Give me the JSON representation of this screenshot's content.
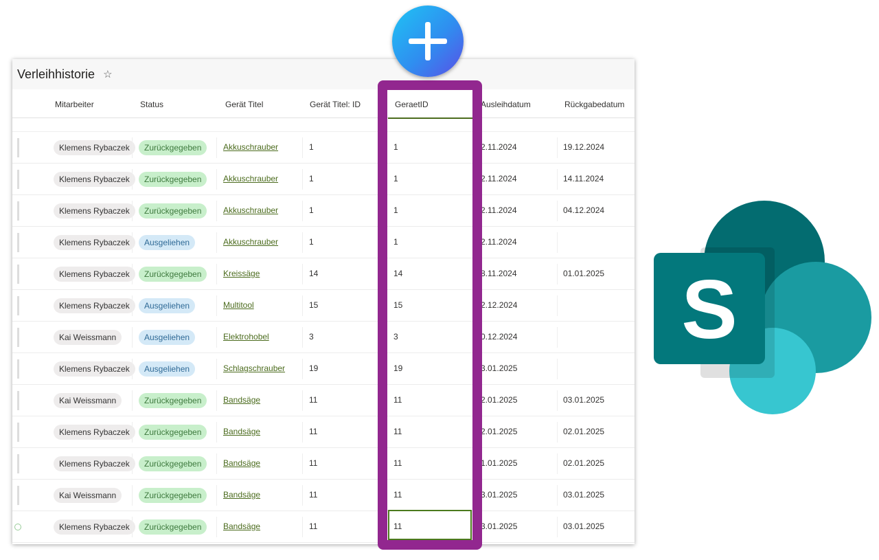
{
  "title": "Verleihhistorie",
  "columns": [
    "Mitarbeiter",
    "Status",
    "Gerät Titel",
    "Gerät Titel: ID",
    "GeraetID",
    "Ausleihdatum",
    "Rückgabedatum"
  ],
  "rows": [
    [
      "Klemens Rybaczek",
      "Zurückgegeben",
      "Akkuschrauber",
      "1",
      "1",
      "2.11.2024",
      "19.12.2024"
    ],
    [
      "Klemens Rybaczek",
      "Zurückgegeben",
      "Akkuschrauber",
      "1",
      "1",
      "2.11.2024",
      "14.11.2024"
    ],
    [
      "Klemens Rybaczek",
      "Zurückgegeben",
      "Akkuschrauber",
      "1",
      "1",
      "2.11.2024",
      "04.12.2024"
    ],
    [
      "Klemens Rybaczek",
      "Ausgeliehen",
      "Akkuschrauber",
      "1",
      "1",
      "2.11.2024",
      ""
    ],
    [
      "Klemens Rybaczek",
      "Zurückgegeben",
      "Kreissäge",
      "14",
      "14",
      "8.11.2024",
      "01.01.2025"
    ],
    [
      "Klemens Rybaczek",
      "Ausgeliehen",
      "Multitool",
      "15",
      "15",
      "2.12.2024",
      ""
    ],
    [
      "Kai Weissmann",
      "Ausgeliehen",
      "Elektrohobel",
      "3",
      "3",
      "0.12.2024",
      ""
    ],
    [
      "Klemens Rybaczek",
      "Ausgeliehen",
      "Schlagschrauber",
      "19",
      "19",
      "3.01.2025",
      ""
    ],
    [
      "Kai Weissmann",
      "Zurückgegeben",
      "Bandsäge",
      "11",
      "11",
      "2.01.2025",
      "03.01.2025"
    ],
    [
      "Klemens Rybaczek",
      "Zurückgegeben",
      "Bandsäge",
      "11",
      "11",
      "2.01.2025",
      "02.01.2025"
    ],
    [
      "Klemens Rybaczek",
      "Zurückgegeben",
      "Bandsäge",
      "11",
      "11",
      "1.01.2025",
      "02.01.2025"
    ],
    [
      "Kai Weissmann",
      "Zurückgegeben",
      "Bandsäge",
      "11",
      "11",
      "3.01.2025",
      "03.01.2025"
    ],
    [
      "Klemens Rybaczek",
      "Zurückgegeben",
      "Bandsäge",
      "11",
      "11",
      "3.01.2025",
      "03.01.2025"
    ]
  ],
  "colors": {
    "highlight_frame": "#92278f",
    "link": "#4b6b1d",
    "returned": "#c8efcb",
    "borrowed": "#d4e9f7"
  },
  "icons": {
    "add": "plus-circle-icon",
    "logo": "sharepoint-logo-icon",
    "favorite": "star-icon"
  }
}
